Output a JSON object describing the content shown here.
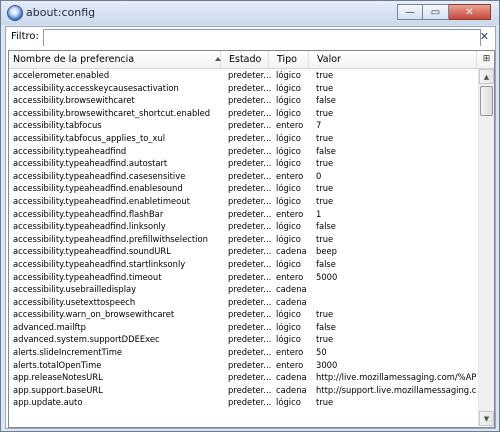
{
  "window": {
    "title": "about:config",
    "minimize_glyph": "—",
    "maximize_glyph": "▭",
    "close_glyph": "✕"
  },
  "filter": {
    "label": "Filtro:",
    "value": "",
    "clear_glyph": "✕"
  },
  "columns": {
    "name": "Nombre de la preferencia",
    "status": "Estado",
    "type": "Tipo",
    "value": "Valor",
    "picker_glyph": "⊞",
    "sort": "ascending"
  },
  "rows": [
    {
      "name": "accelerometer.enabled",
      "status": "predeter...",
      "type": "lógico",
      "value": "true"
    },
    {
      "name": "accessibility.accesskeycausesactivation",
      "status": "predeter...",
      "type": "lógico",
      "value": "true"
    },
    {
      "name": "accessibility.browsewithcaret",
      "status": "predeter...",
      "type": "lógico",
      "value": "false"
    },
    {
      "name": "accessibility.browsewithcaret_shortcut.enabled",
      "status": "predeter...",
      "type": "lógico",
      "value": "true"
    },
    {
      "name": "accessibility.tabfocus",
      "status": "predeter...",
      "type": "entero",
      "value": "7"
    },
    {
      "name": "accessibility.tabfocus_applies_to_xul",
      "status": "predeter...",
      "type": "lógico",
      "value": "true"
    },
    {
      "name": "accessibility.typeaheadfind",
      "status": "predeter...",
      "type": "lógico",
      "value": "false"
    },
    {
      "name": "accessibility.typeaheadfind.autostart",
      "status": "predeter...",
      "type": "lógico",
      "value": "true"
    },
    {
      "name": "accessibility.typeaheadfind.casesensitive",
      "status": "predeter...",
      "type": "entero",
      "value": "0"
    },
    {
      "name": "accessibility.typeaheadfind.enablesound",
      "status": "predeter...",
      "type": "lógico",
      "value": "true"
    },
    {
      "name": "accessibility.typeaheadfind.enabletimeout",
      "status": "predeter...",
      "type": "lógico",
      "value": "true"
    },
    {
      "name": "accessibility.typeaheadfind.flashBar",
      "status": "predeter...",
      "type": "entero",
      "value": "1"
    },
    {
      "name": "accessibility.typeaheadfind.linksonly",
      "status": "predeter...",
      "type": "lógico",
      "value": "false"
    },
    {
      "name": "accessibility.typeaheadfind.prefillwithselection",
      "status": "predeter...",
      "type": "lógico",
      "value": "true"
    },
    {
      "name": "accessibility.typeaheadfind.soundURL",
      "status": "predeter...",
      "type": "cadena",
      "value": "beep"
    },
    {
      "name": "accessibility.typeaheadfind.startlinksonly",
      "status": "predeter...",
      "type": "lógico",
      "value": "false"
    },
    {
      "name": "accessibility.typeaheadfind.timeout",
      "status": "predeter...",
      "type": "entero",
      "value": "5000"
    },
    {
      "name": "accessibility.usebrailledisplay",
      "status": "predeter...",
      "type": "cadena",
      "value": ""
    },
    {
      "name": "accessibility.usetexttospeech",
      "status": "predeter...",
      "type": "cadena",
      "value": ""
    },
    {
      "name": "accessibility.warn_on_browsewithcaret",
      "status": "predeter...",
      "type": "lógico",
      "value": "true"
    },
    {
      "name": "advanced.mailftp",
      "status": "predeter...",
      "type": "lógico",
      "value": "false"
    },
    {
      "name": "advanced.system.supportDDEExec",
      "status": "predeter...",
      "type": "lógico",
      "value": "true"
    },
    {
      "name": "alerts.slideIncrementTime",
      "status": "predeter...",
      "type": "entero",
      "value": "50"
    },
    {
      "name": "alerts.totalOpenTime",
      "status": "predeter...",
      "type": "entero",
      "value": "3000"
    },
    {
      "name": "app.releaseNotesURL",
      "status": "predeter...",
      "type": "cadena",
      "value": "http://live.mozillamessaging.com/%APP..."
    },
    {
      "name": "app.support.baseURL",
      "status": "predeter...",
      "type": "cadena",
      "value": "http://support.live.mozillamessaging.co..."
    },
    {
      "name": "app.update.auto",
      "status": "predeter...",
      "type": "lógico",
      "value": "true"
    }
  ]
}
